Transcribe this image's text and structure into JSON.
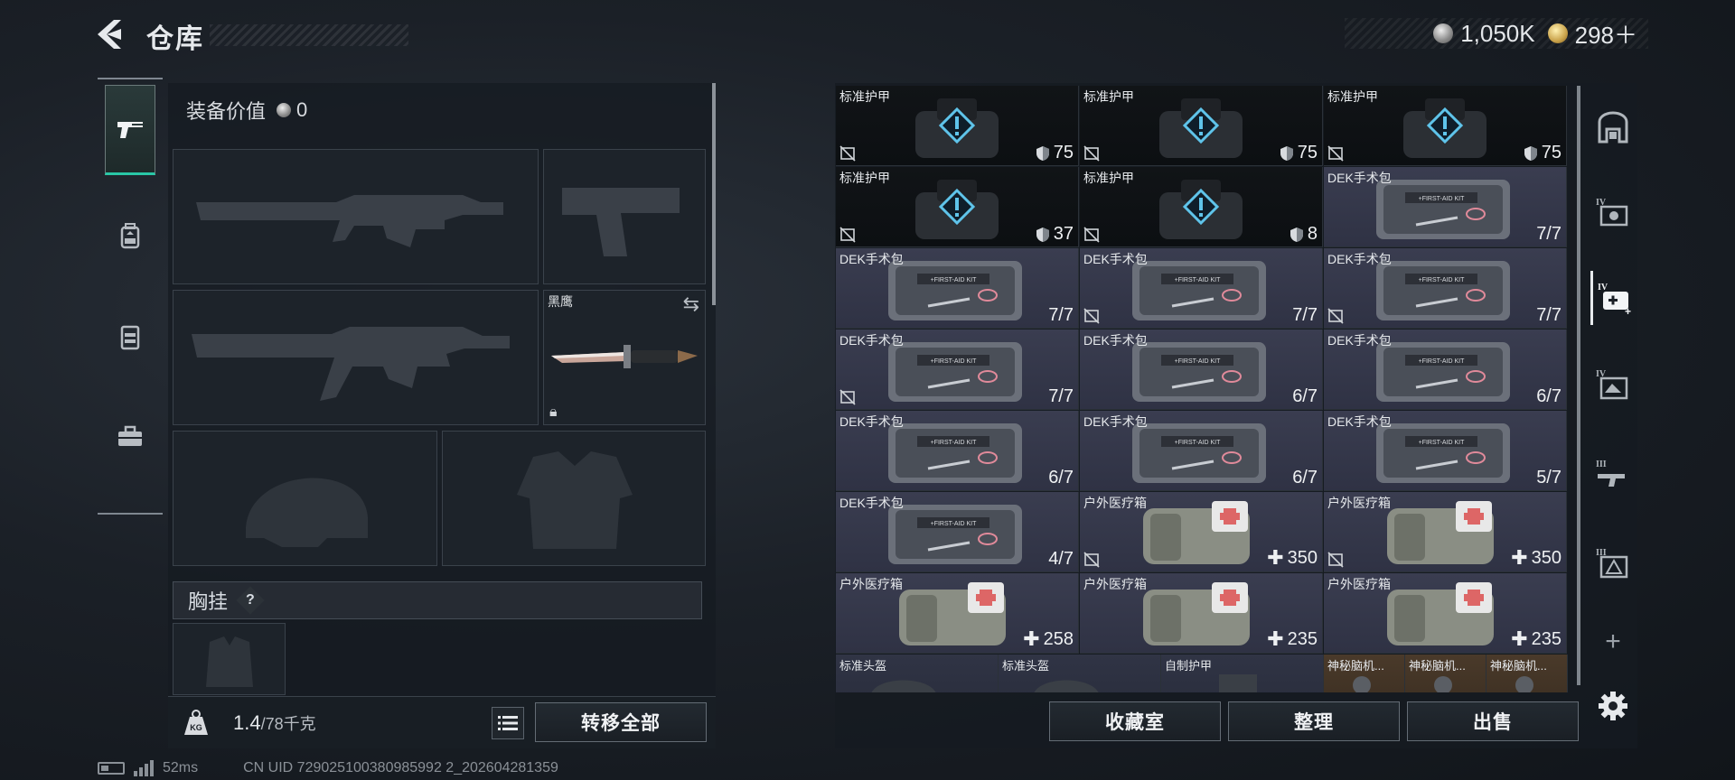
{
  "header": {
    "title": "仓库",
    "back_icon": "back-arrow-icon"
  },
  "currency": [
    {
      "icon": "silver-coin-icon",
      "value": "1,050K"
    },
    {
      "icon": "gold-coin-icon",
      "value": "298＋"
    }
  ],
  "left_tabs": [
    {
      "icon": "pistol-icon",
      "active": true
    },
    {
      "icon": "backpack-icon",
      "active": false
    },
    {
      "icon": "chest-rig-icon",
      "active": false
    },
    {
      "icon": "briefcase-icon",
      "active": false
    }
  ],
  "equipment": {
    "value_label": "装备价值",
    "value": "0",
    "slots": [
      {
        "id": "primary-weapon-1",
        "icon": "assault-rifle-silhouette"
      },
      {
        "id": "sidearm",
        "icon": "pistol-silhouette"
      },
      {
        "id": "primary-weapon-2",
        "icon": "assault-rifle-silhouette"
      },
      {
        "id": "melee",
        "icon": "knife-icon",
        "name": "黑鹰"
      },
      {
        "id": "helmet",
        "icon": "helmet-silhouette"
      },
      {
        "id": "body-armor",
        "icon": "armor-silhouette"
      }
    ],
    "chest_rig_label": "胸挂",
    "chest_rig_help": "?"
  },
  "weight": {
    "current": "1.4",
    "max": "/78千克",
    "icon": "weight-kg-icon"
  },
  "left_actions": {
    "list_icon": "list-icon",
    "transfer_all": "转移全部"
  },
  "inventory": {
    "items": [
      {
        "name": "标准护甲",
        "value": "75",
        "type": "armor",
        "no_insure": true,
        "val_icon": "shield"
      },
      {
        "name": "标准护甲",
        "value": "75",
        "type": "armor",
        "no_insure": true,
        "val_icon": "shield"
      },
      {
        "name": "标准护甲",
        "value": "75",
        "type": "armor",
        "no_insure": true,
        "val_icon": "shield"
      },
      {
        "name": "标准护甲",
        "value": "37",
        "type": "armor",
        "no_insure": true,
        "val_icon": "shield"
      },
      {
        "name": "标准护甲",
        "value": "8",
        "type": "armor",
        "no_insure": true,
        "val_icon": "shield"
      },
      {
        "name": "DEK手术包",
        "value": "7/7",
        "type": "med",
        "no_insure": false,
        "val_icon": ""
      },
      {
        "name": "DEK手术包",
        "value": "7/7",
        "type": "med",
        "no_insure": false,
        "val_icon": ""
      },
      {
        "name": "DEK手术包",
        "value": "7/7",
        "type": "med",
        "no_insure": true,
        "val_icon": ""
      },
      {
        "name": "DEK手术包",
        "value": "7/7",
        "type": "med",
        "no_insure": true,
        "val_icon": ""
      },
      {
        "name": "DEK手术包",
        "value": "7/7",
        "type": "med",
        "no_insure": true,
        "val_icon": ""
      },
      {
        "name": "DEK手术包",
        "value": "6/7",
        "type": "med",
        "no_insure": false,
        "val_icon": ""
      },
      {
        "name": "DEK手术包",
        "value": "6/7",
        "type": "med",
        "no_insure": false,
        "val_icon": ""
      },
      {
        "name": "DEK手术包",
        "value": "6/7",
        "type": "med",
        "no_insure": false,
        "val_icon": ""
      },
      {
        "name": "DEK手术包",
        "value": "6/7",
        "type": "med",
        "no_insure": false,
        "val_icon": ""
      },
      {
        "name": "DEK手术包",
        "value": "5/7",
        "type": "med",
        "no_insure": false,
        "val_icon": ""
      },
      {
        "name": "DEK手术包",
        "value": "4/7",
        "type": "med",
        "no_insure": false,
        "val_icon": ""
      },
      {
        "name": "户外医疗箱",
        "value": "350",
        "type": "medbox",
        "no_insure": true,
        "val_icon": "plus"
      },
      {
        "name": "户外医疗箱",
        "value": "350",
        "type": "medbox",
        "no_insure": true,
        "val_icon": "plus"
      },
      {
        "name": "户外医疗箱",
        "value": "258",
        "type": "medbox",
        "no_insure": false,
        "val_icon": "plus"
      },
      {
        "name": "户外医疗箱",
        "value": "235",
        "type": "medbox",
        "no_insure": false,
        "val_icon": "plus"
      },
      {
        "name": "户外医疗箱",
        "value": "235",
        "type": "medbox",
        "no_insure": false,
        "val_icon": "plus"
      }
    ],
    "bottom_row": [
      {
        "name": "标准头盔",
        "type": "small"
      },
      {
        "name": "标准头盔",
        "type": "small"
      },
      {
        "name": "自制护甲",
        "type": "small"
      },
      {
        "name": "神秘脑机...",
        "type": "orange"
      },
      {
        "name": "神秘脑机...",
        "type": "orange"
      },
      {
        "name": "神秘脑机...",
        "type": "orange"
      }
    ]
  },
  "right_tabs": [
    {
      "icon": "safe-box-icon",
      "active": false
    },
    {
      "icon": "ammo-storage-tier4-icon",
      "active": false
    },
    {
      "icon": "medical-storage-tier4-icon",
      "active": true
    },
    {
      "icon": "equipment-storage-tier4-icon",
      "active": false
    },
    {
      "icon": "weapon-storage-tier3-icon",
      "active": false
    },
    {
      "icon": "armor-storage-tier3-icon",
      "active": false
    }
  ],
  "right_actions": {
    "collection": "收藏室",
    "organize": "整理",
    "sell": "出售",
    "add": "+",
    "settings_icon": "gear-icon"
  },
  "status": {
    "ping": "52ms",
    "uid": "CN UID 729025100380985992 2_202604281359"
  },
  "colors": {
    "accent": "#29c7a6",
    "armor_bg": "#0c0f12",
    "med_bg": "#343749",
    "orange_bg": "#4a3a2a"
  }
}
